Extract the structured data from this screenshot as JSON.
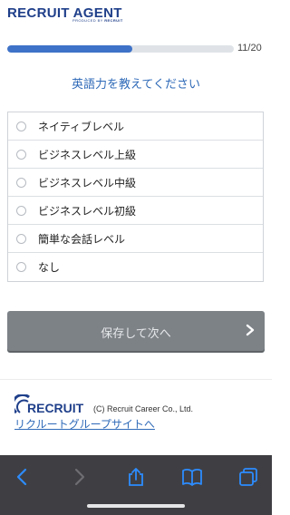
{
  "header": {
    "logo_text": "RECRUIT AGENT",
    "logo_sub_prefix": "PRODUCED BY",
    "logo_sub_brand": "RECRUIT"
  },
  "progress": {
    "fraction": 0.55,
    "label": "11/20"
  },
  "question": "英語力を教えてください",
  "options": [
    {
      "label": "ネイティブレベル",
      "selected": false
    },
    {
      "label": "ビジネスレベル上級",
      "selected": false
    },
    {
      "label": "ビジネスレベル中級",
      "selected": false
    },
    {
      "label": "ビジネスレベル初級",
      "selected": false
    },
    {
      "label": "簡単な会話レベル",
      "selected": false
    },
    {
      "label": "なし",
      "selected": false
    }
  ],
  "submit": {
    "label": "保存して次へ",
    "icon": "chevron-right-icon"
  },
  "footer": {
    "logo_text": "RECRUIT",
    "copyright": "(C) Recruit Career Co., Ltd.",
    "group_link": "リクルートグループサイトへ"
  },
  "browser_toolbar": {
    "items": [
      "back-icon",
      "forward-icon",
      "share-icon",
      "bookmarks-icon",
      "tabs-icon"
    ]
  },
  "colors": {
    "brand": "#1f3f8a",
    "accent": "#3e72c8",
    "link": "#2f6ab8",
    "button": "#7d8287",
    "toolbar": "#3f3f43"
  }
}
